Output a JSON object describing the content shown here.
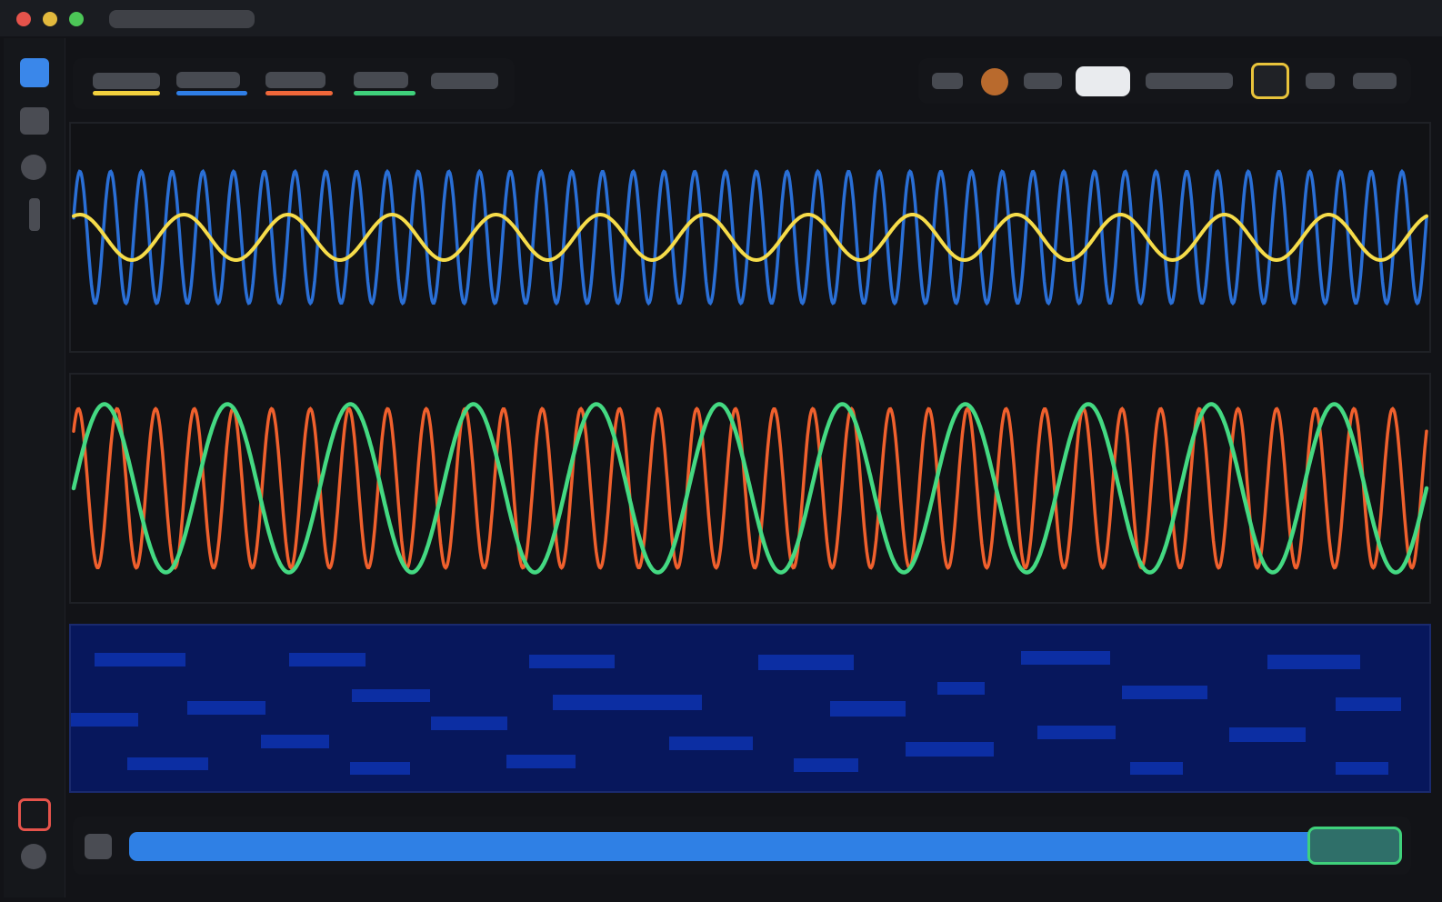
{
  "window": {
    "traffic_lights": [
      {
        "name": "close",
        "color": "#e5534b"
      },
      {
        "name": "minimize",
        "color": "#e2b93d"
      },
      {
        "name": "zoom",
        "color": "#4cc657"
      }
    ]
  },
  "sidebar": {
    "items": [
      {
        "icon": "square-icon",
        "color": "#3a87ea",
        "active": true
      },
      {
        "icon": "square-icon",
        "color": "#4a4c53",
        "active": false
      },
      {
        "icon": "circle-icon",
        "color": "#4a4c53",
        "active": false
      },
      {
        "icon": "bar-icon",
        "color": "#4a4c53",
        "active": false
      }
    ],
    "bottom": [
      {
        "icon": "record-icon",
        "color": "#e5534b"
      },
      {
        "icon": "circle-icon",
        "color": "#4a4c53"
      }
    ]
  },
  "channel_tabs": [
    {
      "color": "#f2d13e"
    },
    {
      "color": "#2f7ee6"
    },
    {
      "color": "#f0673a"
    },
    {
      "color": "#3fd17b"
    },
    {
      "color": null
    }
  ],
  "toolbar": {
    "record_color": "#b96a2d",
    "highlight_color": "#e9ebee",
    "focus_outline_color": "#e9c43b"
  },
  "lanes": [
    {
      "waves": [
        {
          "name": "blue",
          "color": "#2a6fd6",
          "cycles": 44,
          "amplitude": 0.58
        },
        {
          "name": "yellow",
          "color": "#f6dc4a",
          "cycles": 13,
          "amplitude": 0.2
        }
      ]
    },
    {
      "waves": [
        {
          "name": "orange",
          "color": "#f0602d",
          "cycles": 35,
          "amplitude": 0.7
        },
        {
          "name": "green",
          "color": "#44d982",
          "cycles": 11,
          "amplitude": 0.74
        }
      ]
    },
    {
      "piano_roll": {
        "background": "#07175c",
        "note_color": "#0c2ea3"
      }
    }
  ],
  "scrubber": {
    "track_color": "#2f80e5",
    "thumb_color": "#3fd17b",
    "position": 0.95
  }
}
